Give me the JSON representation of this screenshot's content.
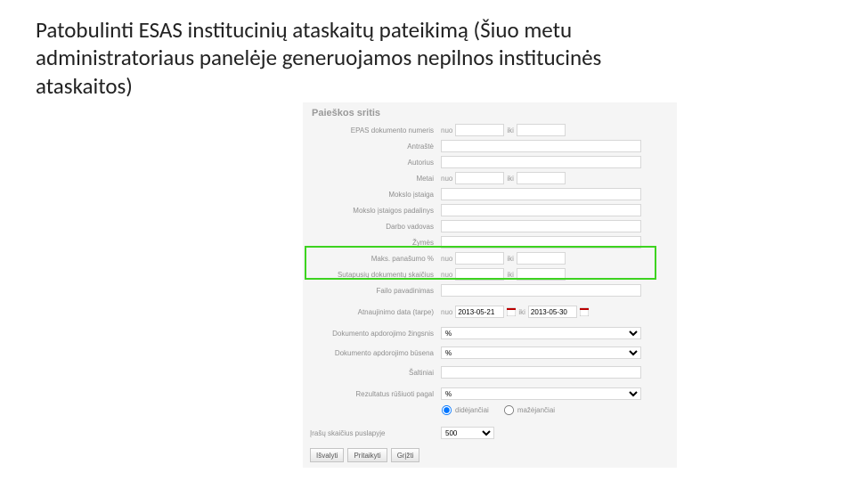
{
  "title": "Patobulinti ESAS institucinių ataskaitų pateikimą (Šiuo metu administratoriaus panelėje generuojamos nepilnos institucinės ataskaitos)",
  "panel": {
    "heading": "Paieškos sritis",
    "labels": {
      "docno": "EPAS dokumento numeris",
      "title": "Antraštė",
      "author": "Autorius",
      "year": "Metai",
      "inst": "Mokslo įstaiga",
      "dept": "Mokslo įstaigos padalinys",
      "supervisor": "Darbo vadovas",
      "tags": "Žymės",
      "maxsim": "Maks. panašumo %",
      "matchcount": "Sutapusių dokumentų skaičius",
      "filename": "Failo pavadinimas",
      "updated": "Atnaujinimo data (tarpe)",
      "step": "Dokumento apdorojimo žingsnis",
      "status": "Dokumento apdorojimo būsena",
      "sources": "Šaltiniai",
      "results": "Rezultatus rūšiuoti pagal",
      "perpage": "Įrašų skaičius puslapyje"
    },
    "sub": {
      "from": "nuo",
      "to": "iki"
    },
    "values": {
      "date_from": "2013-05-21",
      "date_to": "2013-05-30"
    },
    "step_options": [
      "%"
    ],
    "status_options": [
      "%"
    ],
    "sort_options": [
      "%"
    ],
    "perpage_options": [
      "500"
    ],
    "sort_dir": {
      "asc": "didėjančiai",
      "desc": "mažėjančiai"
    },
    "buttons": {
      "clear": "Išvalyti",
      "submit": "Pritaikyti",
      "back": "Grįžti"
    }
  }
}
